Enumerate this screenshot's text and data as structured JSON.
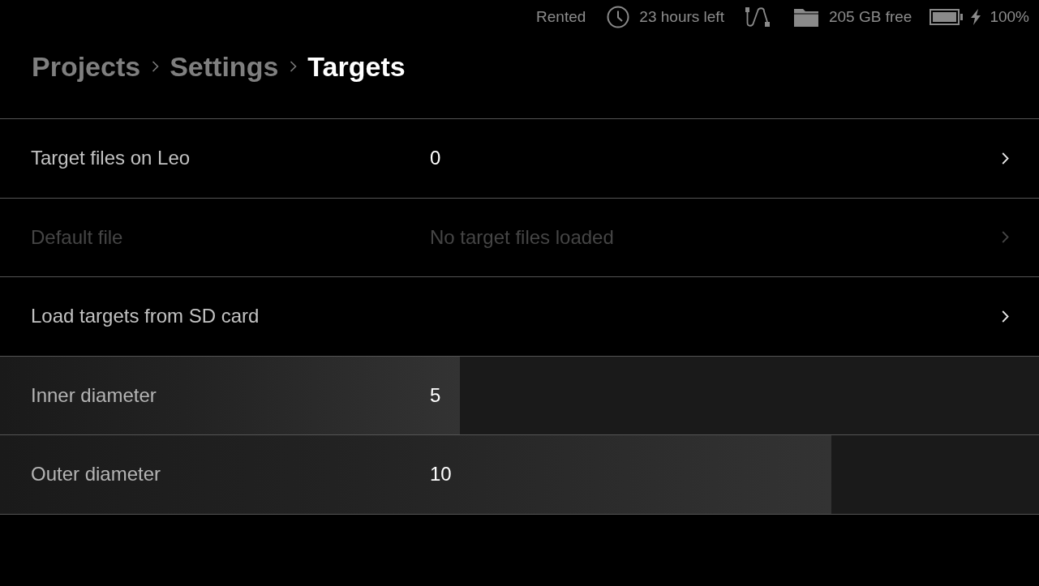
{
  "status_bar": {
    "rental": "Rented",
    "time_left": "23 hours left",
    "cable_connected": true,
    "storage": "205 GB free",
    "battery": "100%",
    "charging": true
  },
  "breadcrumb": [
    {
      "label": "Projects",
      "selected": false
    },
    {
      "label": "Settings",
      "selected": false
    },
    {
      "label": "Targets",
      "selected": true
    }
  ],
  "rows": [
    {
      "kind": "link",
      "label": "Target files on Leo",
      "value": "0",
      "disabled": false
    },
    {
      "kind": "link",
      "label": "Default file",
      "value": "No target files loaded",
      "disabled": true
    },
    {
      "kind": "link",
      "label": "Load targets from SD card",
      "disabled": false
    },
    {
      "kind": "slider",
      "label": "Inner diameter",
      "value": "5",
      "level": 0.443
    },
    {
      "kind": "slider",
      "label": "Outer diameter",
      "value": "10",
      "level": 0.8
    }
  ]
}
